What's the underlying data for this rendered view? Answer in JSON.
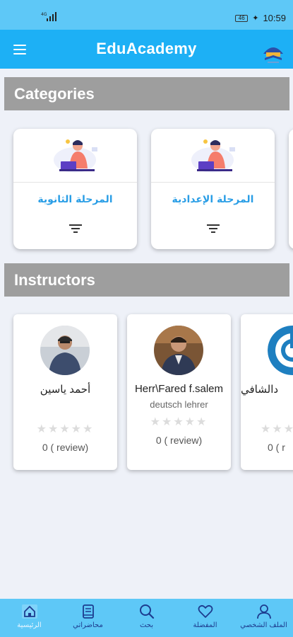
{
  "status_bar": {
    "signal": "4G",
    "battery": "46",
    "time": "10:59"
  },
  "app_bar": {
    "title": "EduAcademy"
  },
  "categories": {
    "header": "Categories",
    "items": [
      {
        "label": "المرحلة الثانوية"
      },
      {
        "label": "المرحلة الإعدادية"
      }
    ]
  },
  "instructors": {
    "header": "Instructors",
    "items": [
      {
        "name": "أحمد ياسين",
        "subtitle": "",
        "rating": 0,
        "reviews": "0 ( review)"
      },
      {
        "name": "Herr\\Fared f.salem",
        "subtitle": "deutsch lehrer",
        "rating": 0,
        "reviews": "0 ( review)"
      },
      {
        "name": "دالشافي",
        "subtitle": "",
        "rating": 0,
        "reviews": "0 ( r"
      }
    ]
  },
  "bottom_nav": {
    "items": [
      {
        "label": "الرئيسية",
        "icon": "home-icon"
      },
      {
        "label": "محاضراتي",
        "icon": "book-icon"
      },
      {
        "label": "بحث",
        "icon": "search-icon"
      },
      {
        "label": "المفضلة",
        "icon": "heart-icon"
      },
      {
        "label": "الملف الشخصي",
        "icon": "person-icon"
      }
    ]
  },
  "colors": {
    "app_bar": "#1db0f5",
    "status_bar": "#5ec8f7",
    "section_header": "#9e9e9e",
    "accent_text": "#2a9ee6",
    "nav_icon": "#1d3c8f"
  }
}
